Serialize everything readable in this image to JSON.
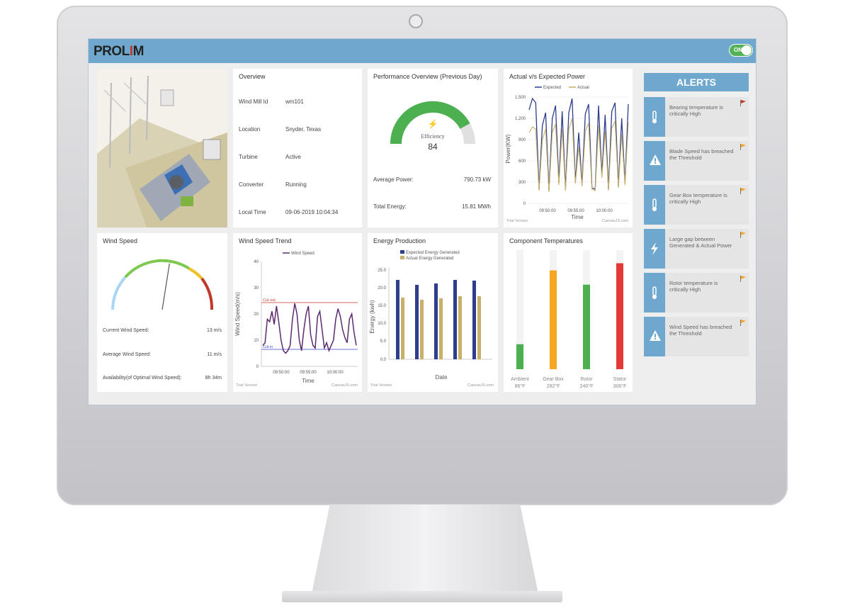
{
  "app": {
    "logo_main": "PROL",
    "logo_accent": "I",
    "logo_end": "M",
    "toggle_label": "ON"
  },
  "overview": {
    "title": "Overview",
    "rows": [
      {
        "label": "Wind Mill Id",
        "value": "wm101"
      },
      {
        "label": "Location",
        "value": "Snyder, Texas"
      },
      {
        "label": "Turbine",
        "value": "Active"
      },
      {
        "label": "Converter",
        "value": "Running"
      },
      {
        "label": "Local Time",
        "value": "09-06-2019 10:04:34"
      }
    ]
  },
  "performance": {
    "title": "Performance Overview (Previous Day)",
    "gauge_label": "Efficiency",
    "gauge_value": "84",
    "gauge_fraction": 0.84,
    "avg_power_label": "Average Power:",
    "avg_power_value": "790.73 kW",
    "total_energy_label": "Total Energy:",
    "total_energy_value": "15.81 MWh"
  },
  "power_chart": {
    "title": "Actual v/s Expected Power",
    "legend_expected": "Expected",
    "legend_actual": "Actual",
    "ylabel": "Power(KW)",
    "xlabel": "Time",
    "yticks": [
      "1,500",
      "1,200",
      "900",
      "600",
      "300",
      "0"
    ],
    "xticks": [
      "09:50:00",
      "09:55:00",
      "10:00:00"
    ],
    "footer_left": "Trial Version",
    "footer_right": "CanvasJS.com"
  },
  "wind_speed": {
    "title": "Wind Speed",
    "gauge_fraction": 0.55,
    "current_label": "Current Wind Speed:",
    "current_value": "13 m/s",
    "average_label": "Average Wind Speed:",
    "average_value": "11 m/s",
    "availability_label": "Availability(of Optimal Wind Speed):",
    "availability_value": "8h 34m"
  },
  "wind_trend": {
    "title": "Wind Speed Trend",
    "legend": "Wind Speed",
    "ylabel": "Wind Speed(m/s)",
    "xlabel": "Time",
    "yticks": [
      "40",
      "30",
      "20",
      "10",
      "0"
    ],
    "xticks": [
      "09:50:00",
      "09:55:00",
      "10:00:00"
    ],
    "cut_out_label": "Cut out",
    "cut_in_label": "Cut in",
    "footer_left": "Trial Version",
    "footer_right": "CanvasJS.com"
  },
  "energy": {
    "title": "Energy Production",
    "legend_expected": "Expected Energy Generated",
    "legend_actual": "Actual Energy Generated",
    "ylabel": "Energy (kwh)",
    "xlabel": "Date",
    "yticks": [
      "25.0",
      "20.0",
      "15.0",
      "10.0",
      "5.0",
      "0.0"
    ],
    "footer_left": "Trial Version",
    "footer_right": "CanvasJS.com"
  },
  "components": {
    "title": "Component Temperatures",
    "items": [
      {
        "name": "Ambient",
        "temp": "86°F",
        "fraction": 0.21,
        "color": "#4caf50"
      },
      {
        "name": "Gear Box",
        "temp": "282°F",
        "fraction": 0.83,
        "color": "#f5a623"
      },
      {
        "name": "Rotor",
        "temp": "240°F",
        "fraction": 0.71,
        "color": "#4caf50"
      },
      {
        "name": "Stator",
        "temp": "306°F",
        "fraction": 0.89,
        "color": "#e53935"
      }
    ]
  },
  "alerts": {
    "title": "ALERTS",
    "items": [
      {
        "icon": "thermometer-icon",
        "message": "Bearing temperature is critically High",
        "flag": "#c0392b"
      },
      {
        "icon": "warning-icon",
        "message": "Blade Speed has breached the Threshold",
        "flag": "#f5a623"
      },
      {
        "icon": "thermometer-icon",
        "message": "Gear Box temperature is critically High",
        "flag": "#f5a623"
      },
      {
        "icon": "bolt-icon",
        "message": "Large gap between Generated & Actual Power",
        "flag": "#f5a623"
      },
      {
        "icon": "thermometer-icon",
        "message": "Rotor temperature is critically High",
        "flag": "#f5a623"
      },
      {
        "icon": "warning-icon",
        "message": "Wind Speed has breached the Threshold",
        "flag": "#f5a623"
      }
    ]
  },
  "colors": {
    "header": "#6fa8cf",
    "expected": "#2c3e8c",
    "actual": "#c8b068",
    "trend": "#5b2a6e"
  }
}
